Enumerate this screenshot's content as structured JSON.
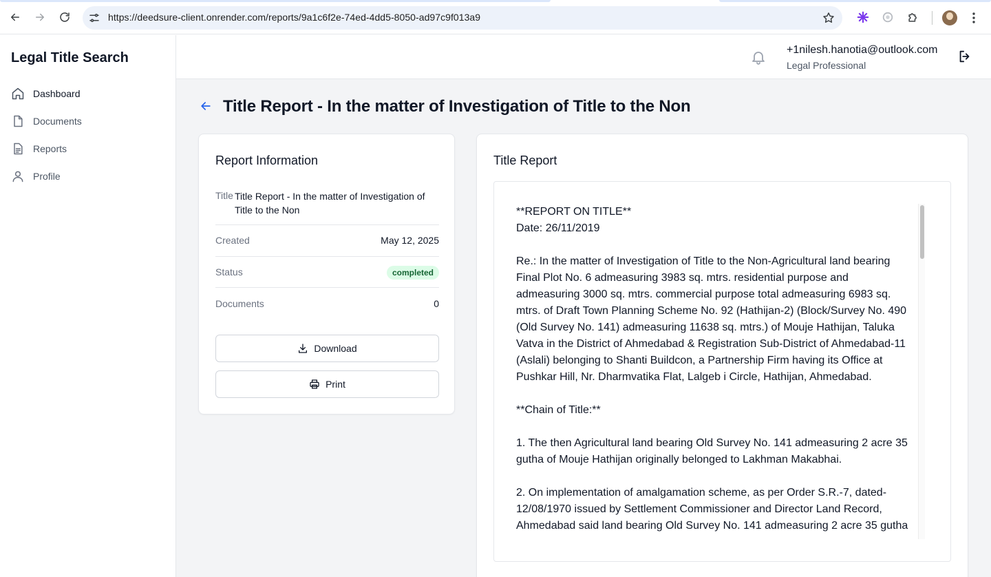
{
  "browser": {
    "url": "https://deedsure-client.onrender.com/reports/9a1c6f2e-74ed-4dd5-8050-ad97c9f013a9"
  },
  "sidebar": {
    "brand": "Legal Title Search",
    "items": [
      {
        "label": "Dashboard",
        "icon": "home-icon",
        "active": true
      },
      {
        "label": "Documents",
        "icon": "document-icon",
        "active": false
      },
      {
        "label": "Reports",
        "icon": "report-icon",
        "active": false
      },
      {
        "label": "Profile",
        "icon": "user-icon",
        "active": false
      }
    ]
  },
  "header": {
    "email": "+1nilesh.hanotia@outlook.com",
    "role": "Legal Professional"
  },
  "page": {
    "title": "Title Report - In the matter of Investigation of Title to the Non"
  },
  "info": {
    "heading": "Report Information",
    "title_label": "Title",
    "title_value": "Title Report - In the matter of Investigation of Title to the Non",
    "created_label": "Created",
    "created_value": "May 12, 2025",
    "status_label": "Status",
    "status_value": "completed",
    "documents_label": "Documents",
    "documents_value": "0",
    "download_label": "Download",
    "print_label": "Print"
  },
  "report": {
    "heading": "Title Report",
    "body": "**REPORT ON TITLE**\nDate: 26/11/2019\n\nRe.: In the matter of Investigation of Title to the Non-Agricultural land bearing Final Plot No. 6 admeasuring 3983 sq. mtrs. residential purpose and admeasuring 3000 sq. mtrs. commercial purpose total admeasuring 6983 sq. mtrs. of Draft Town Planning Scheme No. 92 (Hathijan-2) (Block/Survey No. 490 (Old Survey No. 141) admeasuring 11638 sq. mtrs.) of Mouje Hathijan, Taluka Vatva in the District of Ahmedabad & Registration Sub-District of Ahmedabad-11 (Aslali) belonging to Shanti Buildcon, a Partnership Firm having its Office at Pushkar Hill, Nr. Dharmvatika Flat, Lalgeb i Circle, Hathijan, Ahmedabad.\n\n**Chain of Title:**\n\n1. The then Agricultural land bearing Old Survey No. 141 admeasuring 2 acre 35 gutha of Mouje Hathijan originally belonged to Lakhman Makabhai.\n\n2. On implementation of amalgamation scheme, as per Order S.R.-7, dated-12/08/1970 issued by Settlement Commissioner and Director Land Record, Ahmedabad said land bearing Old Survey No. 141 admeasuring 2 acre 35 gutha"
  },
  "colors": {
    "accent": "#2563eb",
    "badge_bg": "#dcfce7",
    "badge_text": "#166534",
    "main_bg": "#f3f4f6"
  }
}
